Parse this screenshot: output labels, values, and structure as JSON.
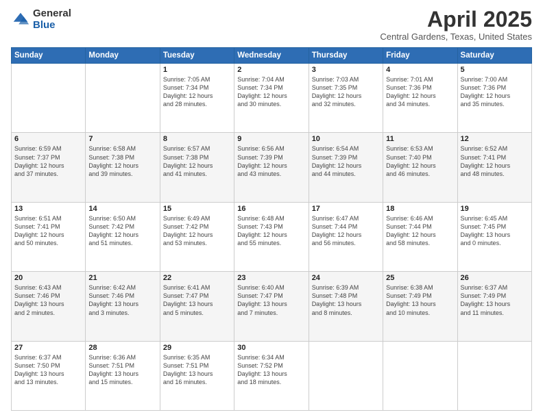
{
  "header": {
    "logo_general": "General",
    "logo_blue": "Blue",
    "month_title": "April 2025",
    "location": "Central Gardens, Texas, United States"
  },
  "days_of_week": [
    "Sunday",
    "Monday",
    "Tuesday",
    "Wednesday",
    "Thursday",
    "Friday",
    "Saturday"
  ],
  "weeks": [
    [
      {
        "day": "",
        "info": ""
      },
      {
        "day": "",
        "info": ""
      },
      {
        "day": "1",
        "info": "Sunrise: 7:05 AM\nSunset: 7:34 PM\nDaylight: 12 hours\nand 28 minutes."
      },
      {
        "day": "2",
        "info": "Sunrise: 7:04 AM\nSunset: 7:34 PM\nDaylight: 12 hours\nand 30 minutes."
      },
      {
        "day": "3",
        "info": "Sunrise: 7:03 AM\nSunset: 7:35 PM\nDaylight: 12 hours\nand 32 minutes."
      },
      {
        "day": "4",
        "info": "Sunrise: 7:01 AM\nSunset: 7:36 PM\nDaylight: 12 hours\nand 34 minutes."
      },
      {
        "day": "5",
        "info": "Sunrise: 7:00 AM\nSunset: 7:36 PM\nDaylight: 12 hours\nand 35 minutes."
      }
    ],
    [
      {
        "day": "6",
        "info": "Sunrise: 6:59 AM\nSunset: 7:37 PM\nDaylight: 12 hours\nand 37 minutes."
      },
      {
        "day": "7",
        "info": "Sunrise: 6:58 AM\nSunset: 7:38 PM\nDaylight: 12 hours\nand 39 minutes."
      },
      {
        "day": "8",
        "info": "Sunrise: 6:57 AM\nSunset: 7:38 PM\nDaylight: 12 hours\nand 41 minutes."
      },
      {
        "day": "9",
        "info": "Sunrise: 6:56 AM\nSunset: 7:39 PM\nDaylight: 12 hours\nand 43 minutes."
      },
      {
        "day": "10",
        "info": "Sunrise: 6:54 AM\nSunset: 7:39 PM\nDaylight: 12 hours\nand 44 minutes."
      },
      {
        "day": "11",
        "info": "Sunrise: 6:53 AM\nSunset: 7:40 PM\nDaylight: 12 hours\nand 46 minutes."
      },
      {
        "day": "12",
        "info": "Sunrise: 6:52 AM\nSunset: 7:41 PM\nDaylight: 12 hours\nand 48 minutes."
      }
    ],
    [
      {
        "day": "13",
        "info": "Sunrise: 6:51 AM\nSunset: 7:41 PM\nDaylight: 12 hours\nand 50 minutes."
      },
      {
        "day": "14",
        "info": "Sunrise: 6:50 AM\nSunset: 7:42 PM\nDaylight: 12 hours\nand 51 minutes."
      },
      {
        "day": "15",
        "info": "Sunrise: 6:49 AM\nSunset: 7:42 PM\nDaylight: 12 hours\nand 53 minutes."
      },
      {
        "day": "16",
        "info": "Sunrise: 6:48 AM\nSunset: 7:43 PM\nDaylight: 12 hours\nand 55 minutes."
      },
      {
        "day": "17",
        "info": "Sunrise: 6:47 AM\nSunset: 7:44 PM\nDaylight: 12 hours\nand 56 minutes."
      },
      {
        "day": "18",
        "info": "Sunrise: 6:46 AM\nSunset: 7:44 PM\nDaylight: 12 hours\nand 58 minutes."
      },
      {
        "day": "19",
        "info": "Sunrise: 6:45 AM\nSunset: 7:45 PM\nDaylight: 13 hours\nand 0 minutes."
      }
    ],
    [
      {
        "day": "20",
        "info": "Sunrise: 6:43 AM\nSunset: 7:46 PM\nDaylight: 13 hours\nand 2 minutes."
      },
      {
        "day": "21",
        "info": "Sunrise: 6:42 AM\nSunset: 7:46 PM\nDaylight: 13 hours\nand 3 minutes."
      },
      {
        "day": "22",
        "info": "Sunrise: 6:41 AM\nSunset: 7:47 PM\nDaylight: 13 hours\nand 5 minutes."
      },
      {
        "day": "23",
        "info": "Sunrise: 6:40 AM\nSunset: 7:47 PM\nDaylight: 13 hours\nand 7 minutes."
      },
      {
        "day": "24",
        "info": "Sunrise: 6:39 AM\nSunset: 7:48 PM\nDaylight: 13 hours\nand 8 minutes."
      },
      {
        "day": "25",
        "info": "Sunrise: 6:38 AM\nSunset: 7:49 PM\nDaylight: 13 hours\nand 10 minutes."
      },
      {
        "day": "26",
        "info": "Sunrise: 6:37 AM\nSunset: 7:49 PM\nDaylight: 13 hours\nand 11 minutes."
      }
    ],
    [
      {
        "day": "27",
        "info": "Sunrise: 6:37 AM\nSunset: 7:50 PM\nDaylight: 13 hours\nand 13 minutes."
      },
      {
        "day": "28",
        "info": "Sunrise: 6:36 AM\nSunset: 7:51 PM\nDaylight: 13 hours\nand 15 minutes."
      },
      {
        "day": "29",
        "info": "Sunrise: 6:35 AM\nSunset: 7:51 PM\nDaylight: 13 hours\nand 16 minutes."
      },
      {
        "day": "30",
        "info": "Sunrise: 6:34 AM\nSunset: 7:52 PM\nDaylight: 13 hours\nand 18 minutes."
      },
      {
        "day": "",
        "info": ""
      },
      {
        "day": "",
        "info": ""
      },
      {
        "day": "",
        "info": ""
      }
    ]
  ]
}
